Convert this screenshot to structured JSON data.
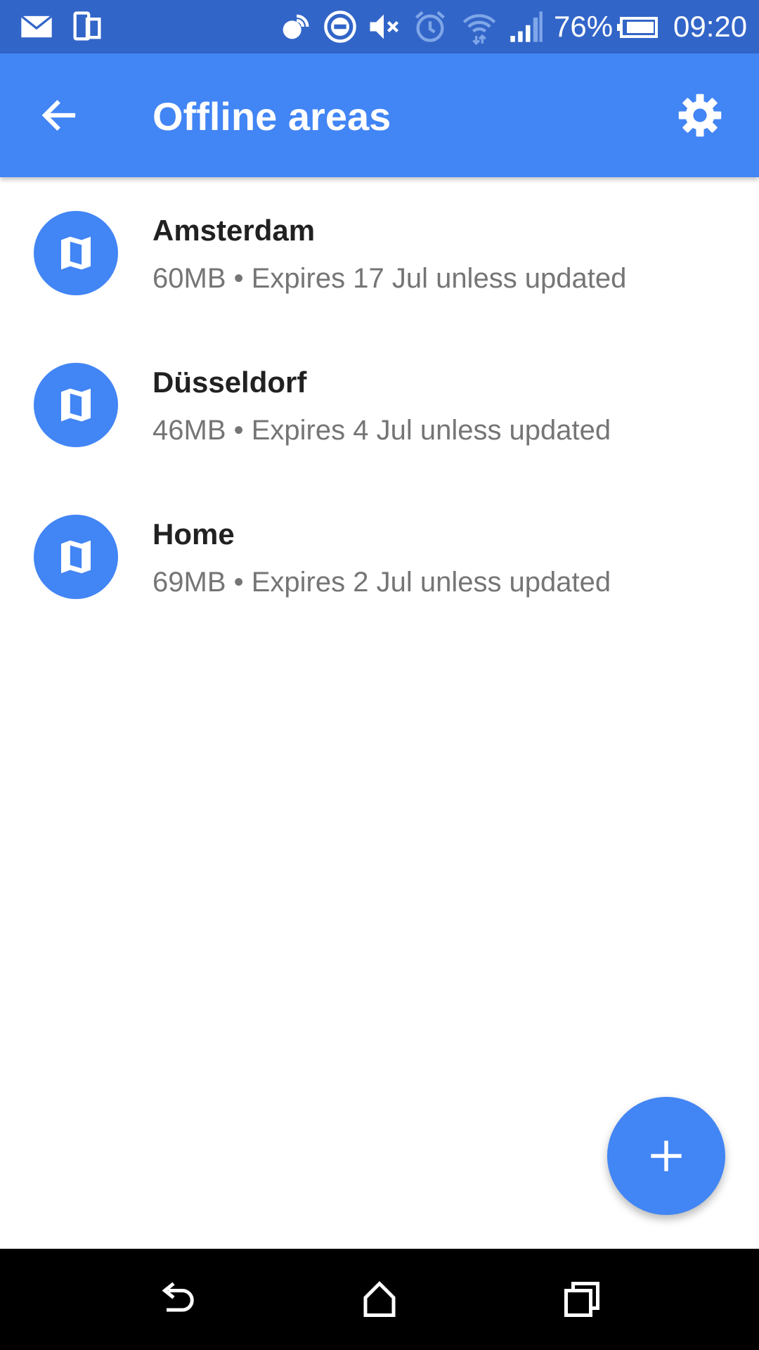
{
  "status_bar": {
    "battery_percent": "76%",
    "time": "09:20",
    "icons": [
      "mail-icon",
      "device-icon",
      "nfc-icon",
      "do-not-disturb-icon",
      "volume-mute-icon",
      "alarm-icon",
      "wifi-icon",
      "cell-signal-icon",
      "battery-icon"
    ]
  },
  "app_bar": {
    "title": "Offline areas",
    "back_icon": "arrow-back-icon",
    "settings_icon": "gear-icon"
  },
  "areas": [
    {
      "name": "Amsterdam",
      "details": "60MB • Expires 17 Jul unless updated",
      "icon": "map-icon"
    },
    {
      "name": "Düsseldorf",
      "details": "46MB • Expires 4 Jul unless updated",
      "icon": "map-icon"
    },
    {
      "name": "Home",
      "details": "69MB • Expires 2 Jul unless updated",
      "icon": "map-icon"
    }
  ],
  "fab": {
    "icon": "plus-icon"
  },
  "nav_bar": {
    "icons": [
      "back-icon",
      "home-icon",
      "recents-icon"
    ]
  },
  "colors": {
    "status_bar": "#3265c8",
    "app_bar": "#4285f4",
    "accent": "#4285f4",
    "title_text": "#212121",
    "secondary_text": "#757575",
    "nav_bar": "#000000"
  }
}
